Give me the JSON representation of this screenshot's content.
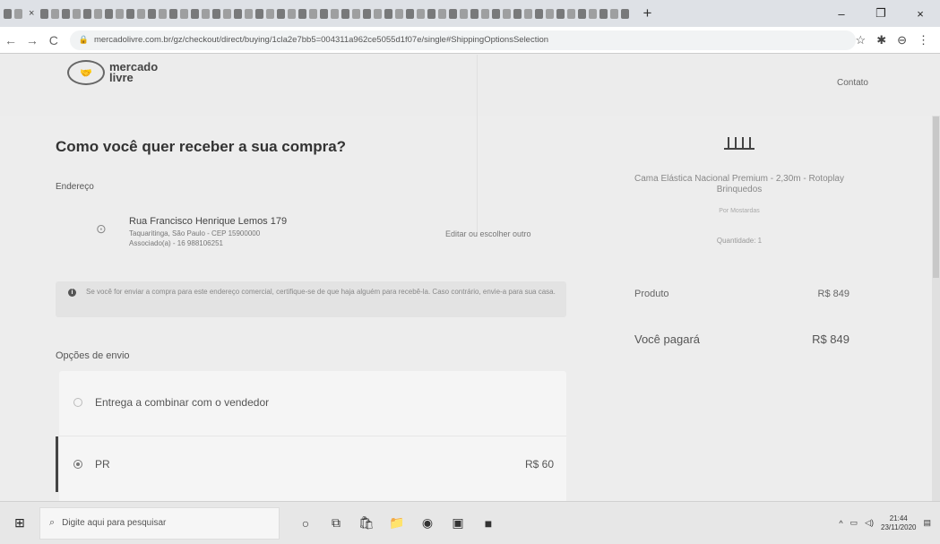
{
  "browser": {
    "tab_close": "×",
    "new_tab": "+",
    "window": {
      "minimize": "–",
      "maximize": "❐",
      "close": "×"
    },
    "url": "mercadolivre.com.br/gz/checkout/direct/buying/1cla2e7bb5=004311a962ce5055d1f07e/single#ShippingOptionsSelection"
  },
  "header": {
    "logo_line1": "mercado",
    "logo_line2": "livre",
    "contact_link": "Contato"
  },
  "checkout": {
    "title": "Como você quer receber a sua compra?",
    "address_section_label": "Endereço",
    "address": {
      "street": "Rua Francisco Henrique Lemos 179",
      "line2": "Taquaritinga, São Paulo - CEP 15900000",
      "line3": "Associado(a) - 16 988106251"
    },
    "edit_link": "Editar ou escolher outro",
    "notice": "Se você for enviar a compra para este endereço comercial, certifique-se de que haja alguém para recebê-la. Caso contrário, envie-a para sua casa.",
    "shipping_section_label": "Opções de envio",
    "options": [
      {
        "label": "Entrega a combinar com o vendedor",
        "price": "",
        "selected": false
      },
      {
        "label": "PR",
        "price": "R$ 60",
        "selected": true
      }
    ]
  },
  "summary": {
    "product_name": "Cama Elástica Nacional Premium - 2,30m - Rotoplay Brinquedos",
    "seller": "Por Mostardas",
    "quantity": "Quantidade: 1",
    "product_label": "Produto",
    "product_price": "R$ 849",
    "total_label": "Você pagará",
    "total_price": "R$ 849"
  },
  "taskbar": {
    "search_placeholder": "Digite aqui para pesquisar",
    "time": "21:44",
    "date": "23/11/2020"
  }
}
